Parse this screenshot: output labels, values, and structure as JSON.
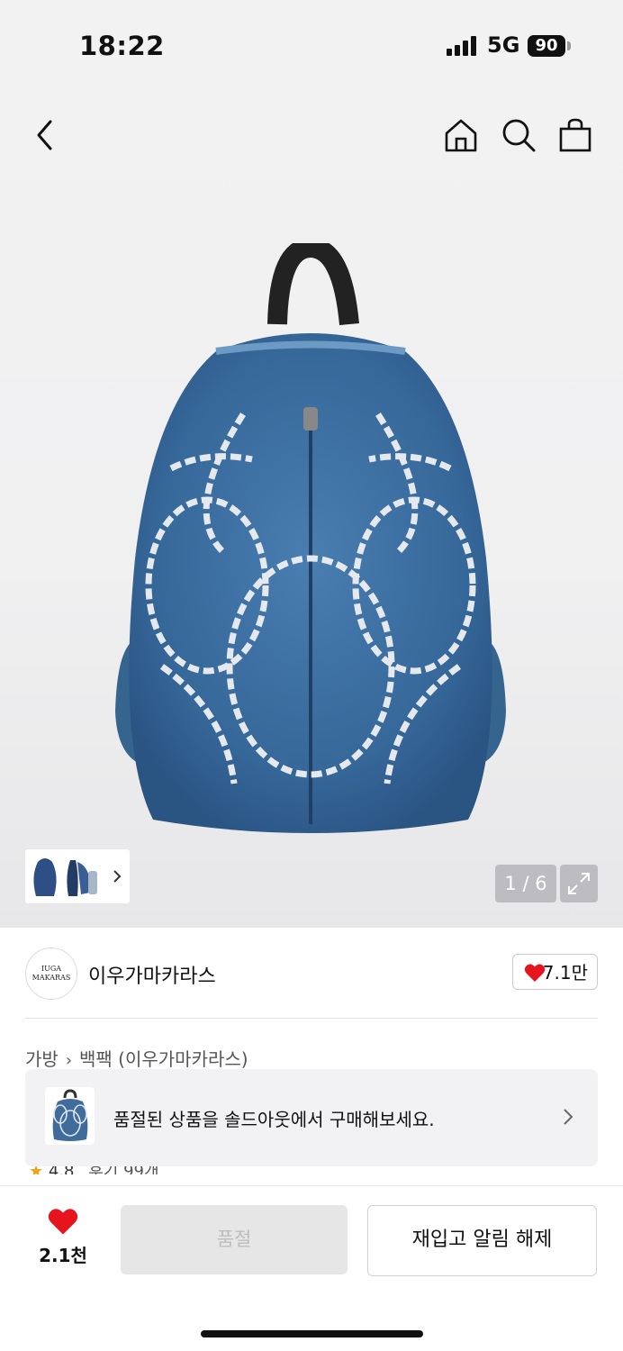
{
  "status_bar": {
    "time": "18:22",
    "network": "5G",
    "battery": "90"
  },
  "header": {
    "back_icon": "chevron-left-icon",
    "home_icon": "home-icon",
    "search_icon": "search-icon",
    "bag_icon": "shopping-bag-icon"
  },
  "gallery": {
    "counter": "1 / 6",
    "expand_icon": "expand-icon",
    "thumb_next_icon": "chevron-right-icon"
  },
  "brand": {
    "logo_line1": "IUGA",
    "logo_line2": "MAKARAS",
    "name": "이우가마카라스",
    "likes": "7.1만"
  },
  "breadcrumb": {
    "level1": "가방",
    "level2": "백팩 (이우가마카라스)"
  },
  "banner": {
    "text": "품절된 상품을 솔드아웃에서 구매해보세요."
  },
  "partial_rating": {
    "score": "4.8",
    "reviews": "후기 99개"
  },
  "bottom_bar": {
    "wish_count": "2.1천",
    "soldout_label": "품절",
    "restock_label": "재입고 알림 해제"
  },
  "colors": {
    "heart": "#e8141d",
    "denim": "#3d6e9e",
    "soldout_bg": "#e6e6e6"
  }
}
